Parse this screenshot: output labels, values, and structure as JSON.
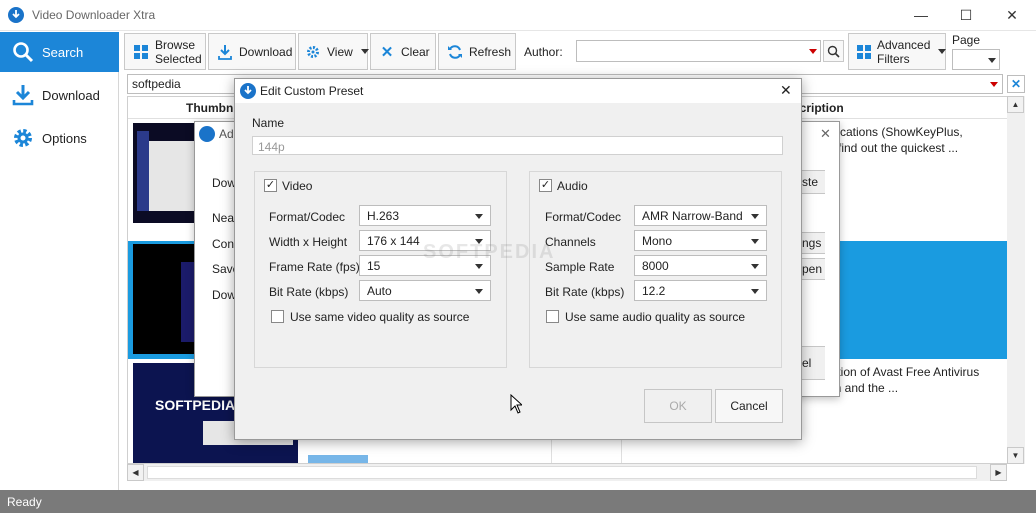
{
  "window": {
    "title": "Video Downloader Xtra",
    "minimize": "—",
    "maximize": "☐",
    "close": "✕"
  },
  "sidebar": {
    "items": [
      {
        "label": "Search",
        "icon": "search-icon",
        "active": true
      },
      {
        "label": "Download",
        "icon": "download-icon",
        "active": false
      },
      {
        "label": "Options",
        "icon": "gear-icon",
        "active": false
      }
    ]
  },
  "toolbar": {
    "browse_line1": "Browse",
    "browse_line2": "Selected",
    "download": "Download",
    "view": "View",
    "clear": "Clear",
    "refresh": "Refresh",
    "author_label": "Author:",
    "author_value": "",
    "advanced_line1": "Advanced",
    "advanced_line2": "Filters",
    "page_label": "Page",
    "page_value": ""
  },
  "search": {
    "query": "softpedia"
  },
  "grid": {
    "headers": {
      "thumbnail": "Thumbn",
      "description": "scription"
    },
    "rows": [
      {
        "desc1": "plications (ShowKeyPlus,",
        "desc2": "o find out the quickest ..."
      },
      {
        "desc1": "",
        "desc2": ""
      },
      {
        "desc1": "dition of Avast Free Antivirus",
        "desc2": "an and the ..."
      }
    ]
  },
  "behind_dialog": {
    "title": "Ad",
    "labels": [
      "Dow",
      "Nea",
      "Con",
      "Save",
      "Dow"
    ],
    "btn_paste": "ste",
    "btn_settings": "ngs",
    "btn_open": "pen",
    "btn_cancel": "el"
  },
  "preset_dialog": {
    "title": "Edit Custom Preset",
    "close": "✕",
    "name_label": "Name",
    "name_placeholder": "144p",
    "video": {
      "enabled_label": "Video",
      "fields": [
        {
          "label": "Format/Codec",
          "value": "H.263"
        },
        {
          "label": "Width x Height",
          "value": "176 x 144"
        },
        {
          "label": "Frame Rate (fps)",
          "value": "15"
        },
        {
          "label": "Bit Rate (kbps)",
          "value": "Auto"
        }
      ],
      "same_quality": "Use same video quality as source"
    },
    "audio": {
      "enabled_label": "Audio",
      "fields": [
        {
          "label": "Format/Codec",
          "value": "AMR Narrow-Band"
        },
        {
          "label": "Channels",
          "value": "Mono"
        },
        {
          "label": "Sample Rate",
          "value": "8000"
        },
        {
          "label": "Bit Rate (kbps)",
          "value": "12.2"
        }
      ],
      "same_quality": "Use same audio quality as source"
    },
    "ok": "OK",
    "cancel": "Cancel"
  },
  "watermark": "SOFTPEDIA",
  "status": {
    "text": "Ready"
  },
  "colors": {
    "accent": "#1c86d8",
    "selected_row": "#1a9be0",
    "status_bar": "#7a7a7a"
  }
}
